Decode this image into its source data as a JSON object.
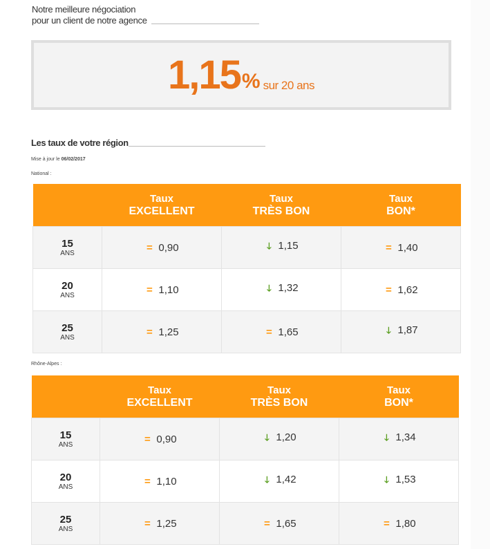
{
  "intro": {
    "line1": "Notre meilleure négociation",
    "line2": "pour un client de notre agence"
  },
  "best_rate": {
    "value": "1,15",
    "percent_sign": "%",
    "duration_text": "sur 20 ans"
  },
  "section": {
    "title": "Les taux de votre région",
    "update_prefix": "Mise à jour le",
    "update_date": "06/02/2017"
  },
  "colors": {
    "accent_orange": "#ff9a11",
    "rate_orange": "#e8741b",
    "down_green": "#5a9e1f"
  },
  "icons": {
    "equal": "=",
    "down": "🡓"
  },
  "tables": [
    {
      "region_label": "National :",
      "headers": [
        {
          "line1": "Taux",
          "line2": "EXCELLENT"
        },
        {
          "line1": "Taux",
          "line2": "TRÈS BON"
        },
        {
          "line1": "Taux",
          "line2": "BON*"
        }
      ],
      "rows": [
        {
          "years": "15",
          "unit": "ANS",
          "cells": [
            {
              "trend": "equal",
              "value": "0,90"
            },
            {
              "trend": "down",
              "value": "1,15"
            },
            {
              "trend": "equal",
              "value": "1,40"
            }
          ]
        },
        {
          "years": "20",
          "unit": "ANS",
          "cells": [
            {
              "trend": "equal",
              "value": "1,10"
            },
            {
              "trend": "down",
              "value": "1,32"
            },
            {
              "trend": "equal",
              "value": "1,62"
            }
          ]
        },
        {
          "years": "25",
          "unit": "ANS",
          "cells": [
            {
              "trend": "equal",
              "value": "1,25"
            },
            {
              "trend": "equal",
              "value": "1,65"
            },
            {
              "trend": "down",
              "value": "1,87"
            }
          ]
        }
      ]
    },
    {
      "region_label": "Rhône-Alpes :",
      "headers": [
        {
          "line1": "Taux",
          "line2": "EXCELLENT"
        },
        {
          "line1": "Taux",
          "line2": "TRÈS BON"
        },
        {
          "line1": "Taux",
          "line2": "BON*"
        }
      ],
      "rows": [
        {
          "years": "15",
          "unit": "ANS",
          "cells": [
            {
              "trend": "equal",
              "value": "0,90"
            },
            {
              "trend": "down",
              "value": "1,20"
            },
            {
              "trend": "down",
              "value": "1,34"
            }
          ]
        },
        {
          "years": "20",
          "unit": "ANS",
          "cells": [
            {
              "trend": "equal",
              "value": "1,10"
            },
            {
              "trend": "down",
              "value": "1,42"
            },
            {
              "trend": "down",
              "value": "1,53"
            }
          ]
        },
        {
          "years": "25",
          "unit": "ANS",
          "cells": [
            {
              "trend": "equal",
              "value": "1,25"
            },
            {
              "trend": "equal",
              "value": "1,65"
            },
            {
              "trend": "equal",
              "value": "1,80"
            }
          ]
        }
      ]
    }
  ]
}
